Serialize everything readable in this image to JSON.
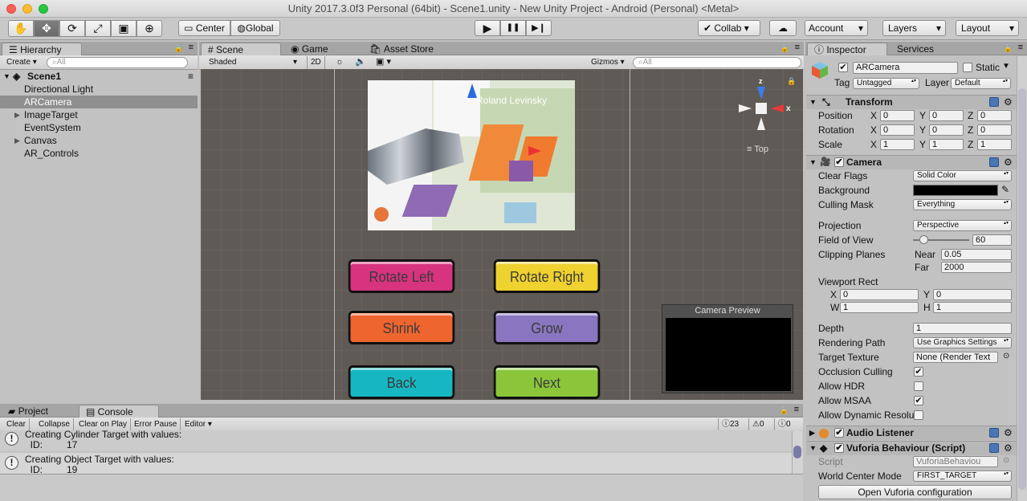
{
  "window": {
    "title": "Unity 2017.3.0f3 Personal (64bit) - Scene1.unity - New Unity Project - Android (Personal) <Metal>"
  },
  "toolbar": {
    "tools": [
      "hand-tool-icon",
      "move-tool-icon",
      "rotate-tool-icon",
      "scale-tool-icon",
      "rect-tool-icon",
      "transform-tool-icon"
    ],
    "pivot": "Center",
    "space": "Global",
    "play_icon": "▶",
    "pause_icon": "❚❚",
    "step_icon": "▶❙",
    "collab": "Collab",
    "account": "Account",
    "layers": "Layers",
    "layout": "Layout"
  },
  "hierarchy": {
    "tab": "Hierarchy",
    "create": "Create",
    "search_placeholder": "All",
    "scene": "Scene1",
    "items": [
      {
        "label": "Directional Light",
        "expand": ""
      },
      {
        "label": "ARCamera",
        "expand": ""
      },
      {
        "label": "ImageTarget",
        "expand": "▶"
      },
      {
        "label": "EventSystem",
        "expand": ""
      },
      {
        "label": "Canvas",
        "expand": "▶"
      },
      {
        "label": "AR_Controls",
        "expand": ""
      }
    ]
  },
  "scene": {
    "tabs": [
      "Scene",
      "Game",
      "Asset Store"
    ],
    "shading": "Shaded",
    "mode2d": "2D",
    "gizmos": "Gizmos",
    "search_placeholder": "All",
    "gizmo_label": "Top",
    "axis_x": "x",
    "axis_z": "z",
    "map_label": "Roland Levinsky",
    "buttons": [
      {
        "label": "Rotate Left",
        "color": "#d8337f"
      },
      {
        "label": "Rotate Right",
        "color": "#efd12f"
      },
      {
        "label": "Shrink",
        "color": "#ef6530"
      },
      {
        "label": "Grow",
        "color": "#8a76c0"
      },
      {
        "label": "Back",
        "color": "#16b7c2"
      },
      {
        "label": "Next",
        "color": "#8bc63a"
      }
    ],
    "camera_preview": "Camera Preview"
  },
  "console": {
    "tabs": [
      "Project",
      "Console"
    ],
    "buttons": [
      "Clear",
      "Collapse",
      "Clear on Play",
      "Error Pause",
      "Editor"
    ],
    "counts": {
      "info": "23",
      "warn": "0",
      "error": "0"
    },
    "entries": [
      {
        "line1": "Creating Cylinder Target with values:",
        "line2": "  ID:         17"
      },
      {
        "line1": "Creating Object Target with values:",
        "line2": "  ID:         19"
      }
    ]
  },
  "inspector": {
    "tabs": [
      "Inspector",
      "Services"
    ],
    "object_name": "ARCamera",
    "static": "Static",
    "tag_label": "Tag",
    "tag": "Untagged",
    "layer_label": "Layer",
    "layer": "Default",
    "transform": {
      "title": "Transform",
      "rows": [
        {
          "label": "Position",
          "x": "0",
          "y": "0",
          "z": "0"
        },
        {
          "label": "Rotation",
          "x": "0",
          "y": "0",
          "z": "0"
        },
        {
          "label": "Scale",
          "x": "1",
          "y": "1",
          "z": "1"
        }
      ]
    },
    "camera": {
      "title": "Camera",
      "clear_flags_label": "Clear Flags",
      "clear_flags": "Solid Color",
      "background_label": "Background",
      "culling_mask_label": "Culling Mask",
      "culling_mask": "Everything",
      "projection_label": "Projection",
      "projection": "Perspective",
      "fov_label": "Field of View",
      "fov": "60",
      "fov_fraction": 0.19,
      "clipping_label": "Clipping Planes",
      "near_label": "Near",
      "near": "0.05",
      "far_label": "Far",
      "far": "2000",
      "viewport_label": "Viewport Rect",
      "vx": "0",
      "vy": "0",
      "vw": "1",
      "vh": "1",
      "depth_label": "Depth",
      "depth": "1",
      "rendering_path_label": "Rendering Path",
      "rendering_path": "Use Graphics Settings",
      "target_texture_label": "Target Texture",
      "target_texture": "None (Render Text",
      "occlusion_label": "Occlusion Culling",
      "hdr_label": "Allow HDR",
      "msaa_label": "Allow MSAA",
      "dyn_label": "Allow Dynamic Resolu"
    },
    "audio": {
      "title": "Audio Listener"
    },
    "vuforia": {
      "title": "Vuforia Behaviour (Script)",
      "script_label": "Script",
      "script": "VuforiaBehaviou",
      "world_center_label": "World Center Mode",
      "world_center": "FIRST_TARGET",
      "open_button": "Open Vuforia configuration"
    }
  }
}
